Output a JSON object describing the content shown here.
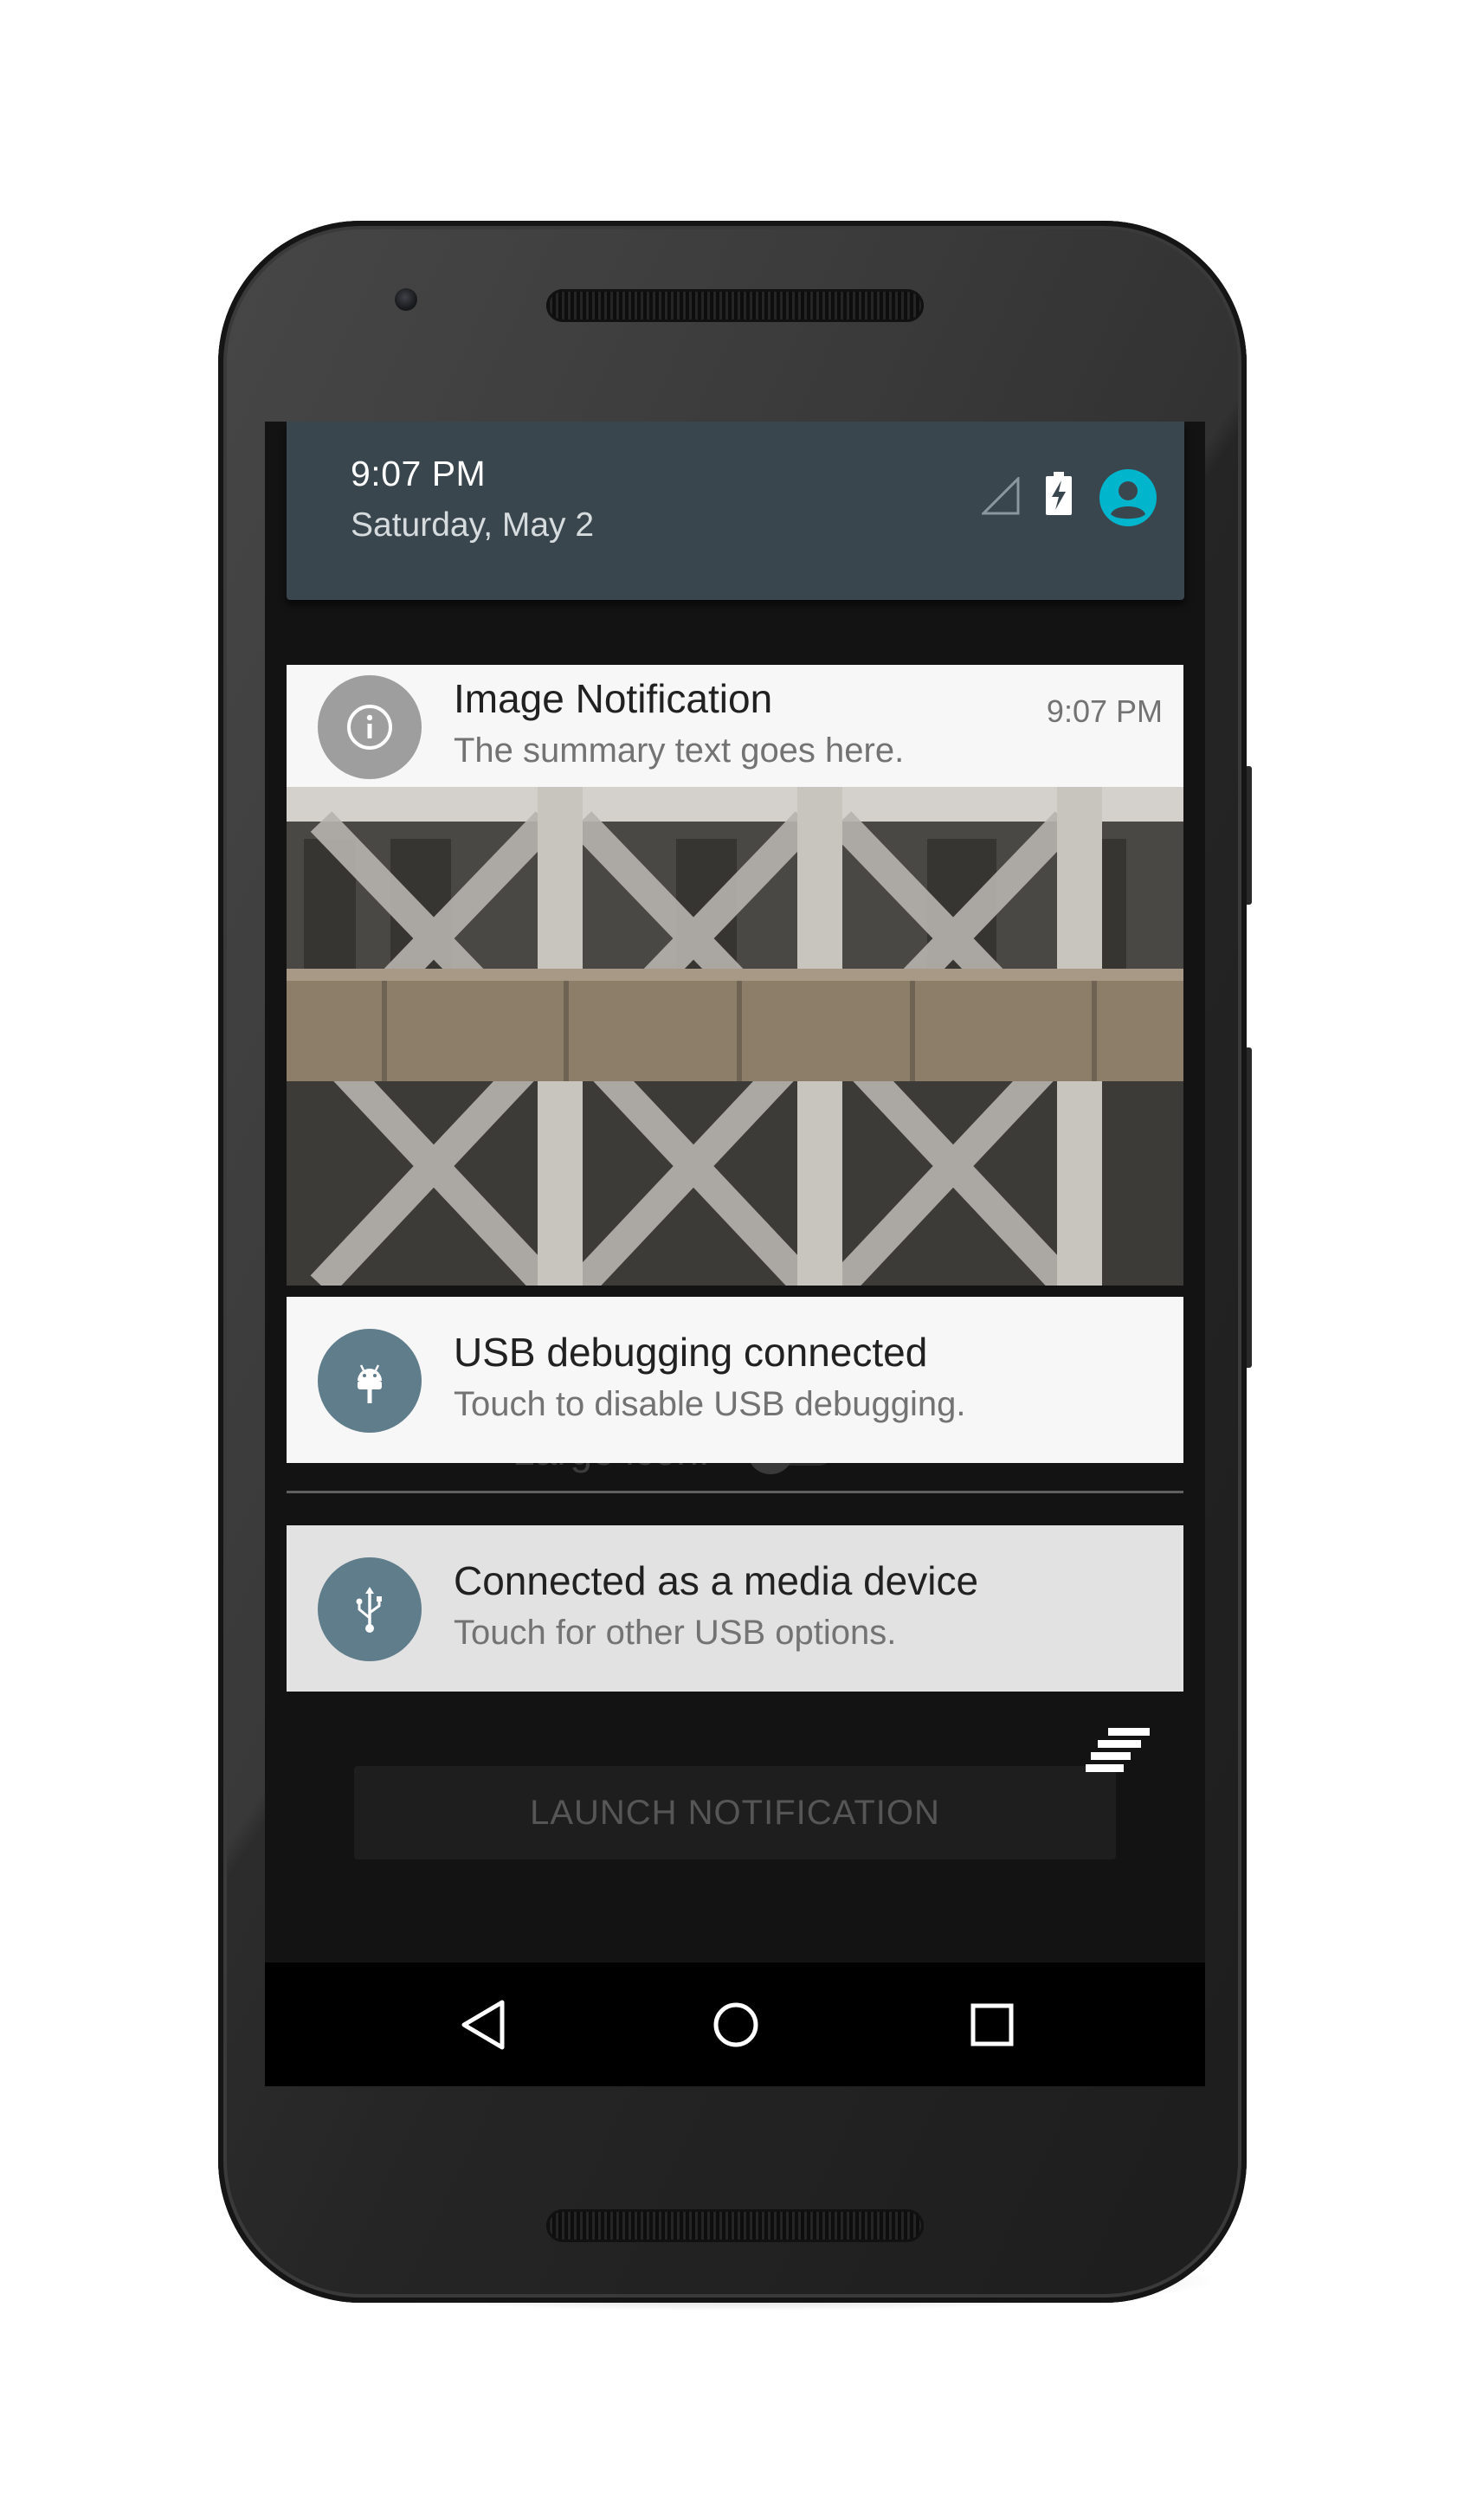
{
  "status_header": {
    "time": "9:07 PM",
    "date": "Saturday, May 2",
    "icons": [
      "signal-icon",
      "battery-charging-icon",
      "user-avatar-icon"
    ],
    "accent_color": "#00b5cc",
    "background_color": "#3a464e"
  },
  "notifications": [
    {
      "icon": "info-icon",
      "icon_bg": "#9e9e9e",
      "title": "Image Notification",
      "text": "The summary text goes here.",
      "time": "9:07 PM",
      "has_big_picture": true
    },
    {
      "icon": "android-icon",
      "icon_bg": "#607d8b",
      "title": "USB debugging connected",
      "text": "Touch to disable USB debugging."
    },
    {
      "icon": "usb-icon",
      "icon_bg": "#607d8b",
      "title": "Connected as a media device",
      "text": "Touch for other USB options."
    }
  ],
  "app_behind": {
    "switch_label": "Large icon:",
    "launch_button_label": "LAUNCH NOTIFICATION"
  },
  "clear_all": {
    "icon": "clear-all-icon"
  },
  "navigation_bar": {
    "buttons": [
      "back-icon",
      "home-icon",
      "recents-icon"
    ]
  }
}
